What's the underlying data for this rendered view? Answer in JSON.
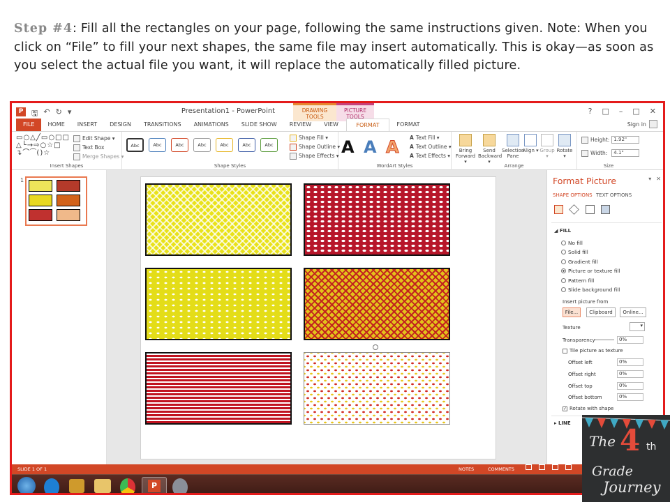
{
  "instruction": {
    "step": "Step #4",
    "text": ": Fill all the rectangles on your page, following the same instructions given. Note: When you click on “File” to fill your next shapes, the same file may insert automatically. This is okay—as soon as you select the actual file you want, it will replace the automatically filled picture."
  },
  "window": {
    "title": "Presentation1 - PowerPoint",
    "context_drawing": "DRAWING TOOLS",
    "context_picture": "PICTURE TOOLS",
    "controls": [
      "?",
      "□",
      "–",
      "□",
      "✕"
    ],
    "signin": "Sign in"
  },
  "tabs": [
    "FILE",
    "HOME",
    "INSERT",
    "DESIGN",
    "TRANSITIONS",
    "ANIMATIONS",
    "SLIDE SHOW",
    "REVIEW",
    "VIEW",
    "FORMAT",
    "FORMAT"
  ],
  "ribbon": {
    "insert_shapes": {
      "edit_shape": "Edit Shape ▾",
      "text_box": "Text Box",
      "merge_shapes": "Merge Shapes ▾",
      "label": "Insert Shapes"
    },
    "shape_styles": {
      "abc": "Abc",
      "shape_fill": "Shape Fill ▾",
      "shape_outline": "Shape Outline ▾",
      "shape_effects": "Shape Effects ▾",
      "label": "Shape Styles"
    },
    "wordart": {
      "letter": "A",
      "text_fill": "Text Fill ▾",
      "text_outline": "Text Outline ▾",
      "text_effects": "Text Effects ▾",
      "label": "WordArt Styles"
    },
    "arrange": {
      "bring_forward": "Bring Forward ▾",
      "send_backward": "Send Backward ▾",
      "selection_pane": "Selection Pane",
      "align": "Align ▾",
      "group": "Group ▾",
      "rotate": "Rotate ▾",
      "label": "Arrange"
    },
    "size": {
      "height_label": "Height:",
      "height": "1.92\"",
      "width_label": "Width:",
      "width": "4.1\"",
      "label": "Size"
    }
  },
  "thumbnail": {
    "number": "1"
  },
  "format_pane": {
    "title": "Format Picture",
    "tab_shape": "SHAPE OPTIONS",
    "tab_text": "TEXT OPTIONS",
    "fill_header": "FILL",
    "fill_options": [
      "No fill",
      "Solid fill",
      "Gradient fill",
      "Picture or texture fill",
      "Pattern fill",
      "Slide background fill"
    ],
    "selected_fill": 3,
    "insert_from": "Insert picture from",
    "file_btn": "File...",
    "clipboard_btn": "Clipboard",
    "online_btn": "Online...",
    "texture": "Texture",
    "transparency": "Transparency",
    "transparency_val": "0%",
    "tile": "Tile picture as texture",
    "offset_left": "Offset left",
    "offset_right": "Offset right",
    "offset_top": "Offset top",
    "offset_bottom": "Offset bottom",
    "offset_val": "0%",
    "rotate_with_shape": "Rotate with shape",
    "line_header": "LINE"
  },
  "statusbar": {
    "slide": "SLIDE 1 OF 1",
    "notes": "NOTES",
    "comments": "COMMENTS"
  },
  "colors": {
    "accent": "#d24726",
    "frame": "#e41b1b",
    "yellow": "#e8e21c",
    "red": "#b71c1c"
  },
  "logo": {
    "the": "The",
    "num": "4",
    "th": "th",
    "grade": "Grade",
    "journey": "Journey"
  }
}
